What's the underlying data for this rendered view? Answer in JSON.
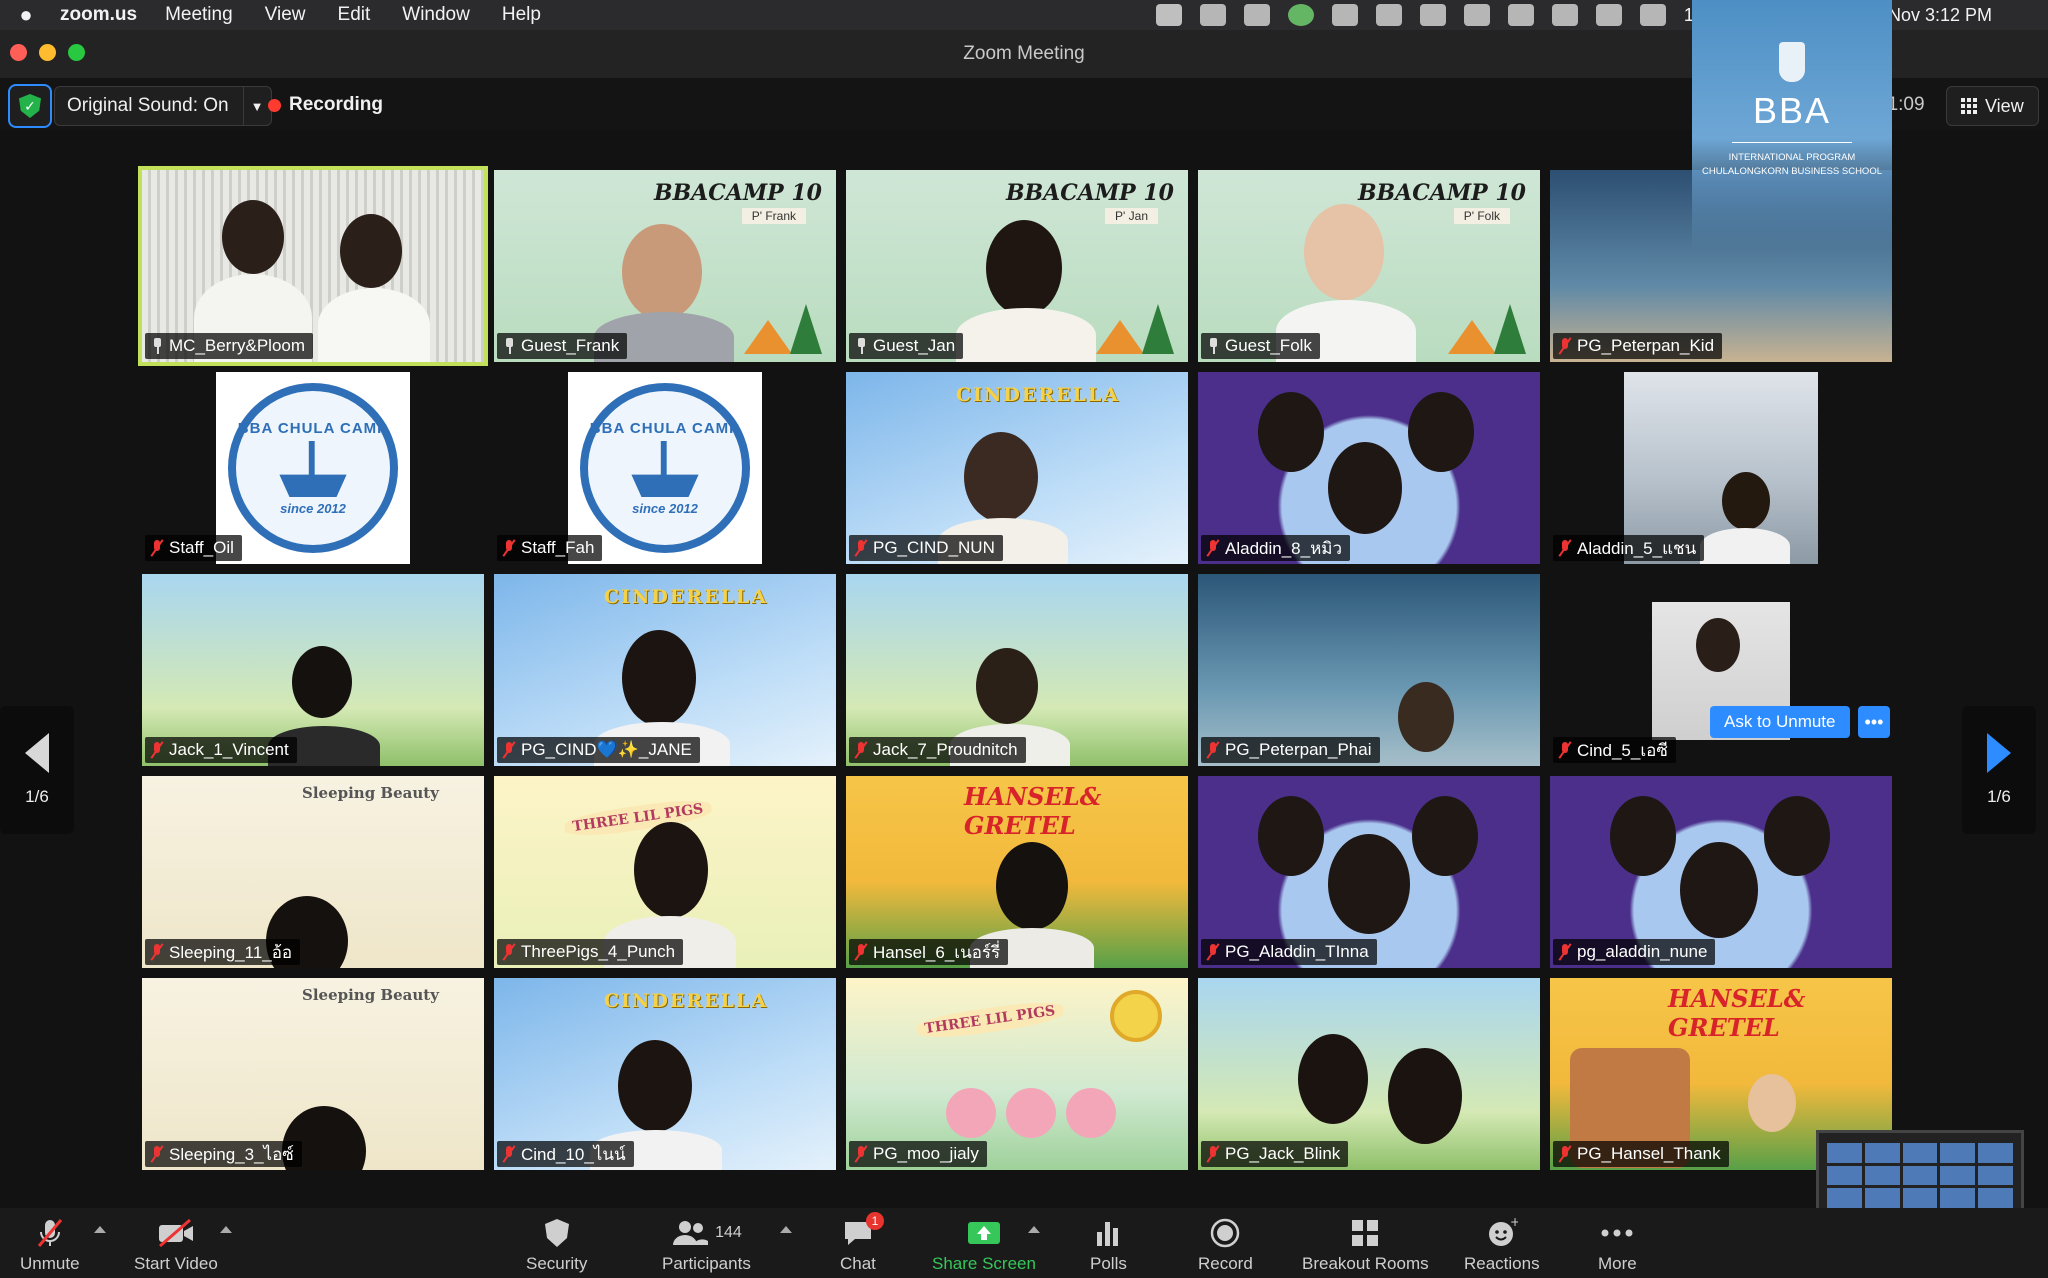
{
  "menubar": {
    "app_name": "zoom.us",
    "items": [
      "Meeting",
      "View",
      "Edit",
      "Window",
      "Help"
    ],
    "battery": "100%",
    "datetime": "Sun 7 Nov  3:12 PM"
  },
  "window": {
    "title": "Zoom Meeting"
  },
  "meeting_bar": {
    "original_sound": "Original Sound: On",
    "recording": "Recording",
    "timer": "07:11:09",
    "view": "View"
  },
  "overlay": {
    "title": "BBA",
    "line1": "INTERNATIONAL PROGRAM",
    "line2": "CHULALONGKORN BUSINESS SCHOOL"
  },
  "pager": {
    "left": "1/6",
    "right": "1/6"
  },
  "banners": {
    "bbacamp": "BBACAMP 10",
    "frank": "P' Frank",
    "jan": "P' Jan",
    "folk": "P' Folk",
    "cinderella": "CINDERELLA",
    "hansel": "HANSEL& GRETEL",
    "sleeping": "Sleeping Beauty",
    "pigs": "THREE LIL PIGS",
    "camp_logo_top": "BBA CHULA CAMP",
    "camp_logo_bottom": "since 2012"
  },
  "ask_unmute": "Ask to Unmute",
  "more_dots": "•••",
  "participants": [
    {
      "name": "MC_Berry&Ploom"
    },
    {
      "name": "Guest_Frank"
    },
    {
      "name": "Guest_Jan"
    },
    {
      "name": "Guest_Folk"
    },
    {
      "name": "PG_Peterpan_Kid"
    },
    {
      "name": "Staff_Oil"
    },
    {
      "name": "Staff_Fah"
    },
    {
      "name": "PG_CIND_NUN"
    },
    {
      "name": "Aladdin_8_หมิว"
    },
    {
      "name": "Aladdin_5_แชน"
    },
    {
      "name": "Jack_1_Vincent"
    },
    {
      "name": "PG_CIND💙✨_JANE"
    },
    {
      "name": "Jack_7_Proudnitch"
    },
    {
      "name": "PG_Peterpan_Phai"
    },
    {
      "name": "Cind_5_เอซี"
    },
    {
      "name": "Sleeping_11_อ้อ"
    },
    {
      "name": "ThreePigs_4_Punch"
    },
    {
      "name": "Hansel_6_เนอร์รี่"
    },
    {
      "name": "PG_Aladdin_TInna"
    },
    {
      "name": "pg_aladdin_nune"
    },
    {
      "name": "Sleeping_3_ไอซ์"
    },
    {
      "name": "Cind_10_ไนน์"
    },
    {
      "name": "PG_moo_jialy"
    },
    {
      "name": "PG_Jack_Blink"
    },
    {
      "name": "PG_Hansel_Thank"
    }
  ],
  "toolbar": {
    "unmute": "Unmute",
    "start_video": "Start Video",
    "security": "Security",
    "participants": "Participants",
    "participant_count": "144",
    "chat": "Chat",
    "chat_badge": "1",
    "share_screen": "Share Screen",
    "polls": "Polls",
    "record": "Record",
    "breakout": "Breakout Rooms",
    "reactions": "Reactions",
    "more": "More"
  }
}
